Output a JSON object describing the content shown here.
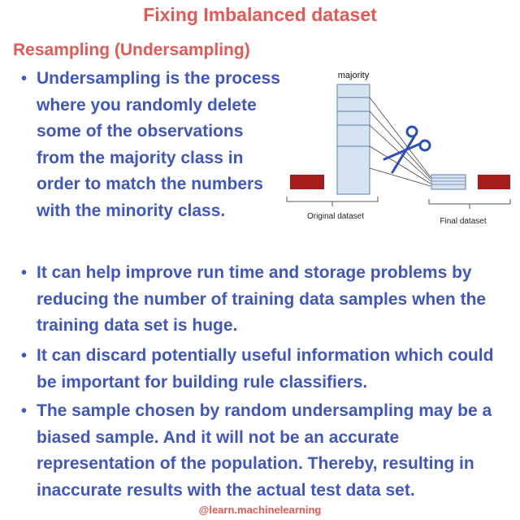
{
  "title": "Fixing Imbalanced dataset",
  "subtitle": "Resampling (Undersampling)",
  "bullets": [
    "Undersampling is the process where you randomly delete some of the observations from the majority class in order to match the numbers with the minority class.",
    "It can help improve run time and storage problems by reducing the number of training data samples when the training data set is huge.",
    "It can discard potentially useful information which could be important for building rule classifiers.",
    "The sample chosen by random undersampling may be a biased sample. And it will not be an accurate representation of the population. Thereby, resulting in inaccurate results with the actual test data set."
  ],
  "diagram": {
    "majority_label": "majority",
    "original_label": "Original dataset",
    "final_label": "Final dataset"
  },
  "footer": "@learn.machinelearning",
  "colors": {
    "heading": "#e05a56",
    "body_text": "#3f57be",
    "minority_bar": "#a51c1c",
    "majority_bar": "#d6e4f2"
  }
}
